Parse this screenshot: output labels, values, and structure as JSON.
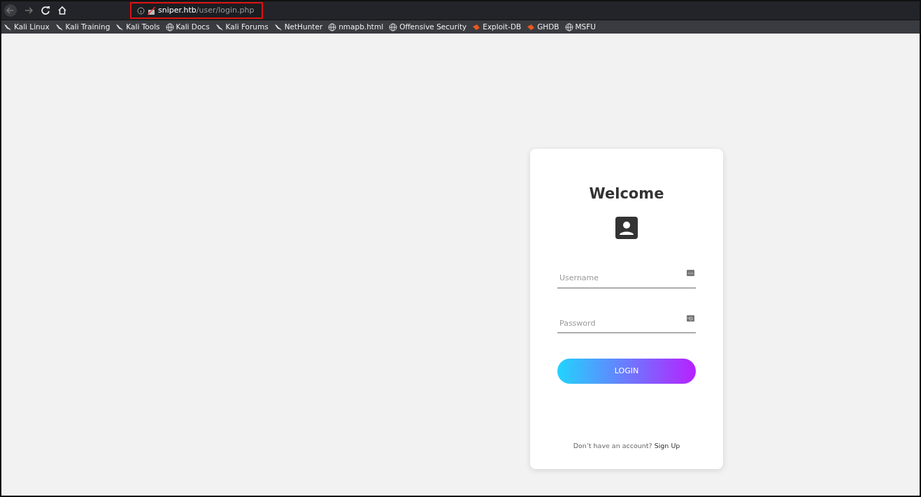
{
  "address_bar": {
    "host": "sniper.htb",
    "path": "/user/login.php"
  },
  "bookmarks": [
    {
      "label": "Kali Linux",
      "kind": "kali"
    },
    {
      "label": "Kali Training",
      "kind": "kali"
    },
    {
      "label": "Kali Tools",
      "kind": "kali"
    },
    {
      "label": "Kali Docs",
      "kind": "globe"
    },
    {
      "label": "Kali Forums",
      "kind": "kali"
    },
    {
      "label": "NetHunter",
      "kind": "kali"
    },
    {
      "label": "nmapb.html",
      "kind": "globe"
    },
    {
      "label": "Offensive Security",
      "kind": "globe"
    },
    {
      "label": "Exploit-DB",
      "kind": "exploit"
    },
    {
      "label": "GHDB",
      "kind": "exploit"
    },
    {
      "label": "MSFU",
      "kind": "globe"
    }
  ],
  "login": {
    "title": "Welcome",
    "fields": [
      {
        "placeholder": "Username",
        "kind": "text"
      },
      {
        "placeholder": "Password",
        "kind": "password"
      }
    ],
    "button": "LOGIN",
    "footer_text": "Don’t have an account?",
    "footer_link": "Sign Up"
  }
}
